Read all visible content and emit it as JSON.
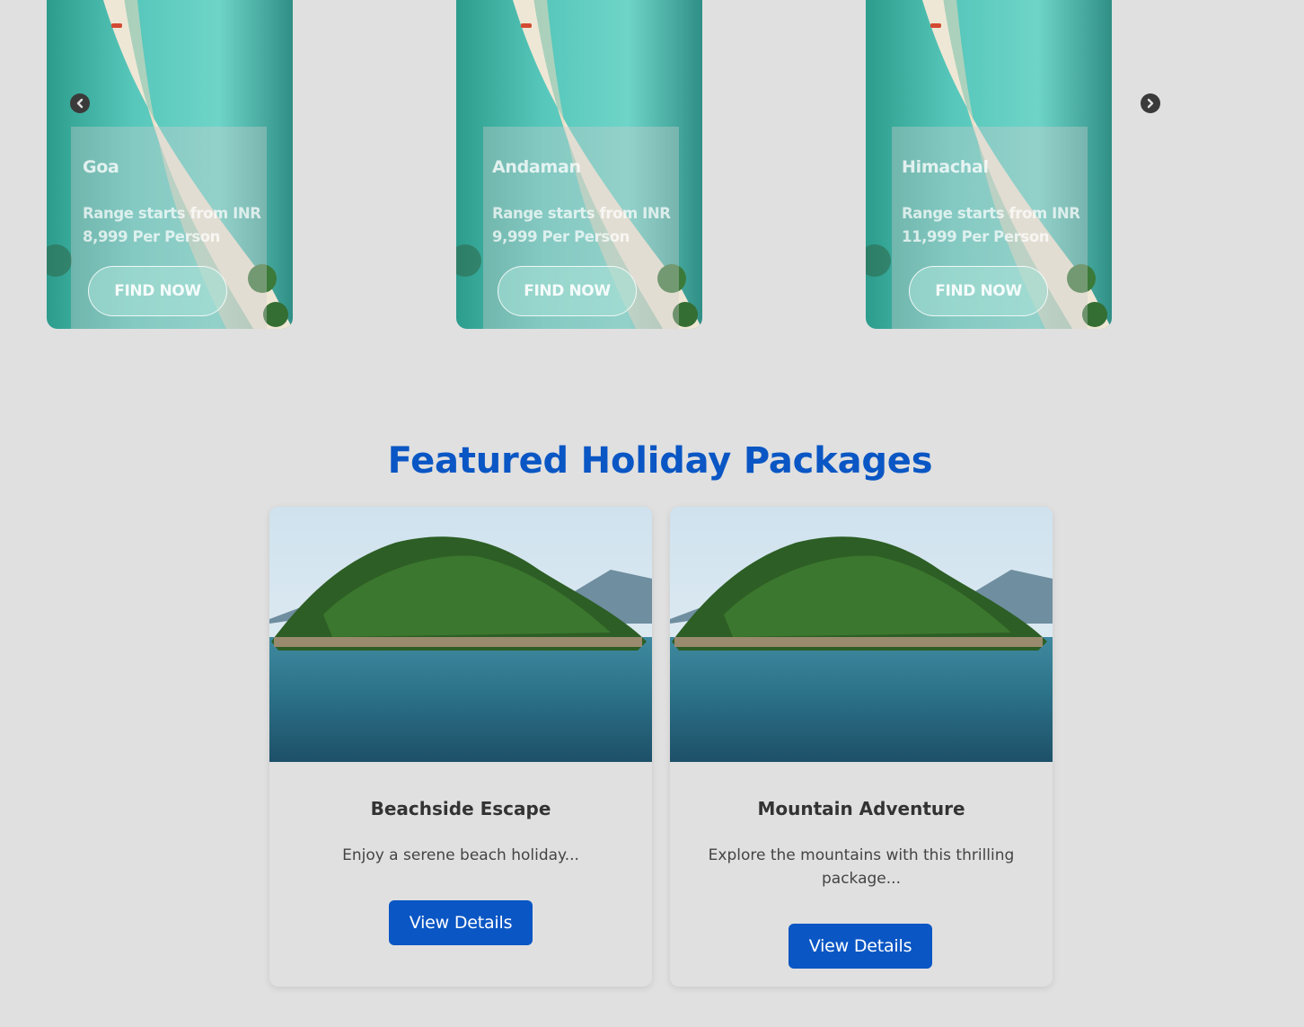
{
  "carousel": {
    "prev_icon": "chevron-left-icon",
    "next_icon": "chevron-right-icon",
    "slides": [
      {
        "title": "Goa",
        "price": "Range starts from INR 8,999 Per Person",
        "button": "FIND NOW"
      },
      {
        "title": "Andaman",
        "price": "Range starts from INR 9,999 Per Person",
        "button": "FIND NOW"
      },
      {
        "title": "Himachal",
        "price": "Range starts from INR 11,999 Per Person",
        "button": "FIND NOW"
      }
    ]
  },
  "featured": {
    "heading": "Featured Holiday Packages",
    "packages": [
      {
        "title": "Beachside Escape",
        "description": "Enjoy a serene beach holiday...",
        "button": "View Details"
      },
      {
        "title": "Mountain Adventure",
        "description": "Explore the mountains with this thrilling package...",
        "button": "View Details"
      }
    ]
  },
  "colors": {
    "accent": "#0a56c4",
    "background": "#e0e0e0"
  }
}
